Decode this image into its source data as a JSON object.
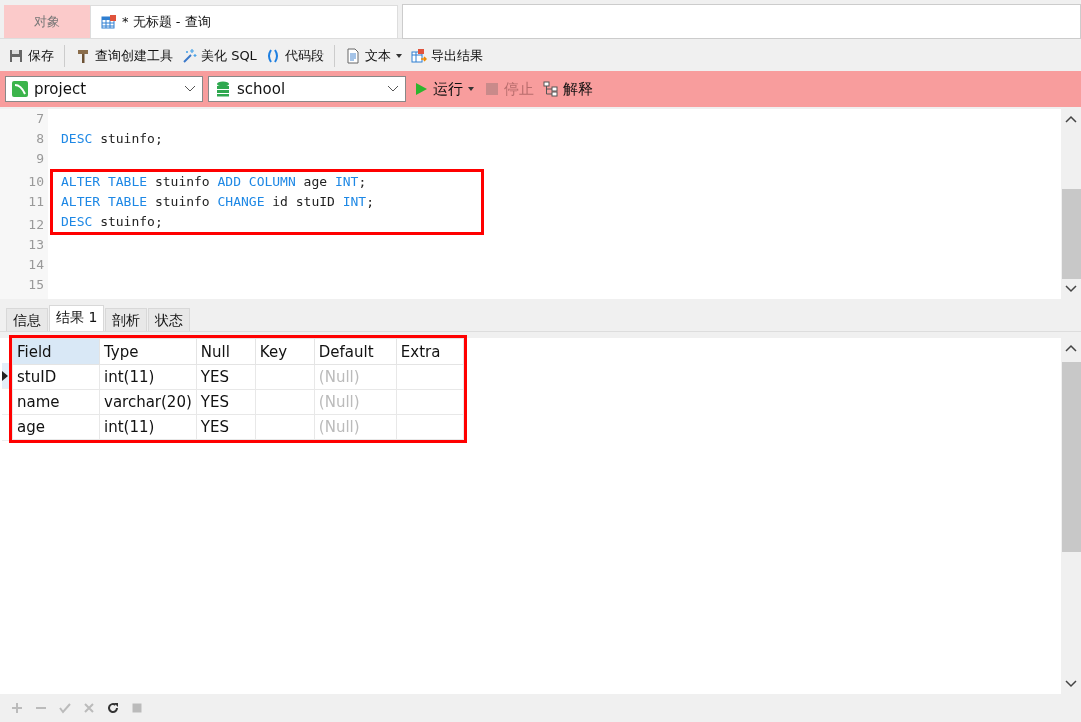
{
  "doc_tabs": [
    {
      "label": "对象",
      "selected": false,
      "icon": false
    },
    {
      "label": "* 无标题 - 查询",
      "selected": true,
      "icon": true
    }
  ],
  "toolbar": [
    {
      "kind": "save",
      "label": "保存"
    },
    {
      "kind": "sep"
    },
    {
      "kind": "builder",
      "label": "查询创建工具"
    },
    {
      "kind": "beautify",
      "label": "美化 SQL"
    },
    {
      "kind": "snippet",
      "label": "代码段"
    },
    {
      "kind": "sep"
    },
    {
      "kind": "text",
      "label": "文本",
      "dropdown": true
    },
    {
      "kind": "export",
      "label": "导出结果"
    }
  ],
  "connection": {
    "value": "project"
  },
  "database": {
    "value": "school"
  },
  "run": {
    "label": "运行",
    "disabled": false
  },
  "stop": {
    "label": "停止",
    "disabled": true
  },
  "explain": {
    "label": "解释",
    "disabled": false
  },
  "editor_lines": [
    {
      "number": "7",
      "highlighted": false
    },
    {
      "number": "8",
      "highlighted": false,
      "tokens": [
        {
          "text": "DESC",
          "keyword": true
        },
        {
          "text": "stuinfo;",
          "keyword": false
        }
      ]
    },
    {
      "number": "9",
      "highlighted": false
    },
    {
      "number": "10",
      "highlighted": true,
      "tokens": [
        {
          "text": "ALTER",
          "keyword": true
        },
        {
          "text": "TABLE",
          "keyword": true
        },
        {
          "text": "stuinfo",
          "keyword": false
        },
        {
          "text": "ADD",
          "keyword": true
        },
        {
          "text": "COLUMN",
          "keyword": true
        },
        {
          "text": "age",
          "keyword": false
        },
        {
          "text": "INT",
          "keyword": true
        },
        {
          "text": ";",
          "keyword": false,
          "attached": true
        }
      ]
    },
    {
      "number": "11",
      "highlighted": true,
      "tokens": [
        {
          "text": "ALTER",
          "keyword": true
        },
        {
          "text": "TABLE",
          "keyword": true
        },
        {
          "text": "stuinfo",
          "keyword": false
        },
        {
          "text": "CHANGE",
          "keyword": true
        },
        {
          "text": "id",
          "keyword": false
        },
        {
          "text": "stuID",
          "keyword": false
        },
        {
          "text": "INT",
          "keyword": true
        },
        {
          "text": ";",
          "keyword": false,
          "attached": true
        }
      ]
    },
    {
      "number": "12",
      "highlighted": true,
      "tokens": [
        {
          "text": "DESC",
          "keyword": true
        },
        {
          "text": "stuinfo;",
          "keyword": false
        }
      ]
    },
    {
      "number": "13",
      "highlighted": false
    },
    {
      "number": "14",
      "highlighted": false
    },
    {
      "number": "15",
      "highlighted": false
    }
  ],
  "result_tabs": [
    {
      "label": "信息",
      "selected": false
    },
    {
      "label": "结果 1",
      "selected": true
    },
    {
      "label": "剖析",
      "selected": false
    },
    {
      "label": "状态",
      "selected": false
    }
  ],
  "result_table": {
    "highlighted": true,
    "columns": [
      "Field",
      "Type",
      "Null",
      "Key",
      "Default",
      "Extra"
    ],
    "rows": [
      {
        "selected": true,
        "cells": [
          {
            "text": "stuID",
            "null": false
          },
          {
            "text": "int(11)",
            "null": false
          },
          {
            "text": "YES",
            "null": false
          },
          {},
          {
            "text": "(Null)",
            "null": true
          },
          {}
        ]
      },
      {
        "selected": false,
        "cells": [
          {
            "text": "name",
            "null": false
          },
          {
            "text": "varchar(20)",
            "null": false
          },
          {
            "text": "YES",
            "null": false
          },
          {},
          {
            "text": "(Null)",
            "null": true
          },
          {}
        ]
      },
      {
        "selected": false,
        "cells": [
          {
            "text": "age",
            "null": false
          },
          {
            "text": "int(11)",
            "null": false
          },
          {
            "text": "YES",
            "null": false
          },
          {},
          {
            "text": "(Null)",
            "null": true
          },
          {}
        ]
      }
    ]
  },
  "grid_actions": [
    {
      "kind": "add",
      "disabled": true
    },
    {
      "kind": "remove",
      "disabled": true
    },
    {
      "kind": "apply",
      "disabled": true
    },
    {
      "kind": "discard",
      "disabled": true
    },
    {
      "kind": "refresh",
      "disabled": false
    },
    {
      "kind": "stop",
      "disabled": true
    }
  ]
}
